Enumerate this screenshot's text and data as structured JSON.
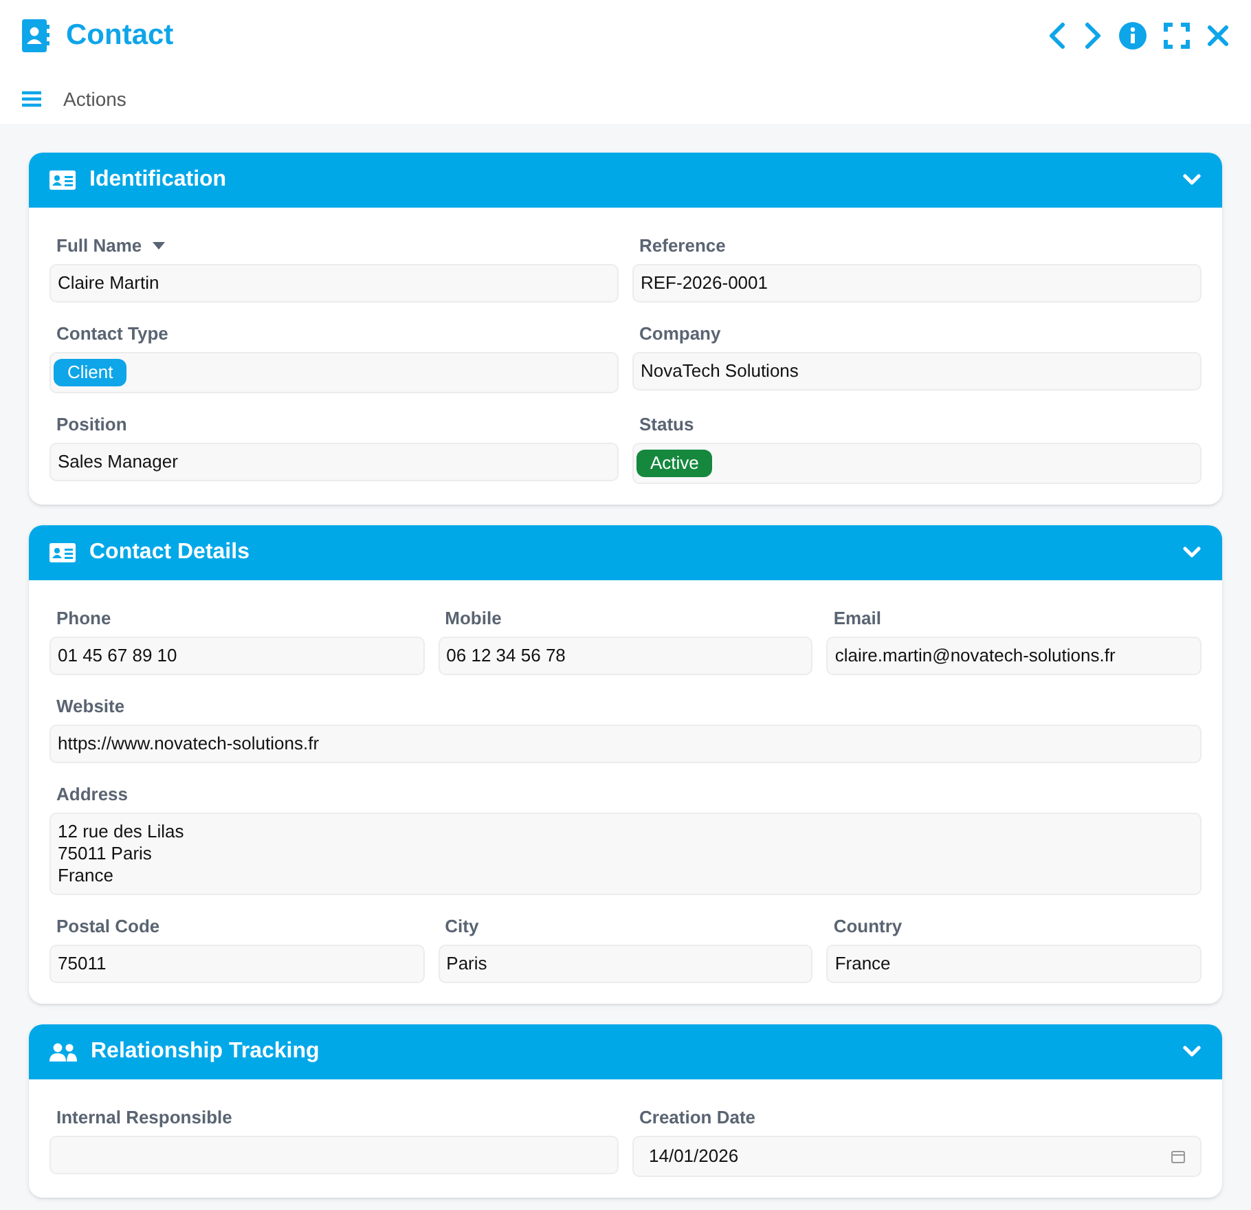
{
  "window": {
    "title": "Contact"
  },
  "toolbar": {
    "menu_label": "Actions"
  },
  "sections": [
    {
      "title": "Identification",
      "kind": "card",
      "expanded": true,
      "rows": [
        {
          "fields": [
            {
              "label": "Full Name",
              "kind": "text",
              "value": "Claire Martin",
              "sortable": true
            },
            {
              "label": "Reference",
              "kind": "text",
              "value": "REF-2026-0001"
            }
          ]
        },
        {
          "fields": [
            {
              "label": "Contact Type",
              "kind": "tag",
              "value": "Client",
              "color": "#0ea5e9"
            },
            {
              "label": "Company",
              "kind": "text",
              "value": "NovaTech Solutions"
            }
          ]
        },
        {
          "fields": [
            {
              "label": "Position",
              "kind": "text",
              "value": "Sales Manager"
            },
            {
              "label": "Status",
              "kind": "tag",
              "value": "Active",
              "color": "#15883e"
            }
          ]
        }
      ]
    },
    {
      "title": "Contact Details",
      "kind": "card",
      "expanded": true,
      "rows": [
        {
          "fields": [
            {
              "label": "Phone",
              "kind": "text",
              "value": "01 45 67 89 10"
            },
            {
              "label": "Mobile",
              "kind": "text",
              "value": "06 12 34 56 78"
            },
            {
              "label": "Email",
              "kind": "text",
              "value": "claire.martin@novatech-solutions.fr"
            }
          ]
        },
        {
          "fields": [
            {
              "label": "Website",
              "kind": "text",
              "value": "https://www.novatech-solutions.fr"
            }
          ]
        },
        {
          "fields": [
            {
              "label": "Address",
              "kind": "textarea",
              "lines": [
                "12 rue des Lilas",
                "75011 Paris",
                "France"
              ]
            }
          ]
        },
        {
          "fields": [
            {
              "label": "Postal Code",
              "kind": "text",
              "value": "75011"
            },
            {
              "label": "City",
              "kind": "text",
              "value": "Paris"
            },
            {
              "label": "Country",
              "kind": "text",
              "value": "France"
            }
          ]
        }
      ]
    },
    {
      "title": "Relationship Tracking",
      "kind": "people",
      "expanded": true,
      "rows": [
        {
          "fields": [
            {
              "label": "Internal Responsible",
              "kind": "text"
            },
            {
              "label": "Creation Date",
              "kind": "date",
              "value": "14/01/2026"
            }
          ]
        }
      ]
    }
  ]
}
